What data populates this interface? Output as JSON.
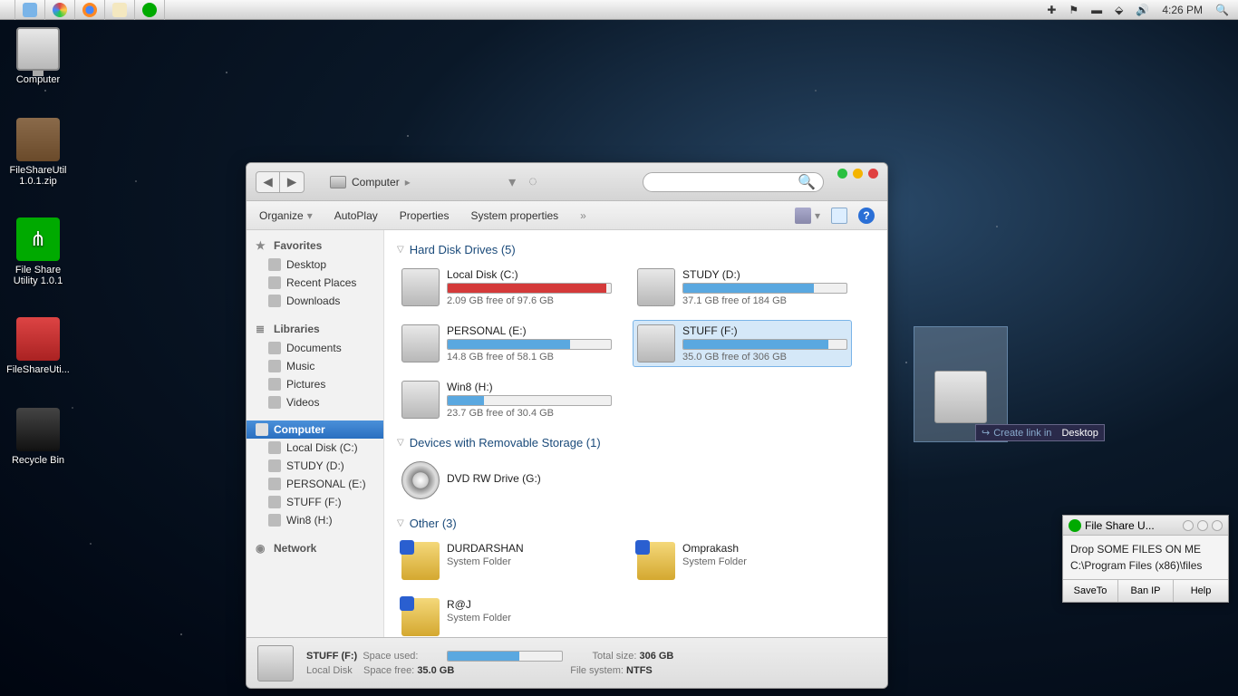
{
  "menubar": {
    "time": "4:26 PM"
  },
  "desktop": [
    {
      "name": "Computer"
    },
    {
      "name": "FileShareUtil 1.0.1.zip"
    },
    {
      "name": "File Share Utility 1.0.1"
    },
    {
      "name": "FileShareUti..."
    },
    {
      "name": "Recycle Bin"
    }
  ],
  "explorer": {
    "breadcrumb": "Computer",
    "toolbar": {
      "organize": "Organize",
      "autoplay": "AutoPlay",
      "properties": "Properties",
      "sysprops": "System properties"
    },
    "sidebar": {
      "favorites": {
        "label": "Favorites",
        "items": [
          "Desktop",
          "Recent Places",
          "Downloads"
        ]
      },
      "libraries": {
        "label": "Libraries",
        "items": [
          "Documents",
          "Music",
          "Pictures",
          "Videos"
        ]
      },
      "computer": {
        "label": "Computer",
        "items": [
          "Local Disk (C:)",
          "STUDY (D:)",
          "PERSONAL (E:)",
          "STUFF (F:)",
          "Win8 (H:)"
        ]
      },
      "network": {
        "label": "Network"
      }
    },
    "groups": {
      "hdd": {
        "label": "Hard Disk Drives (5)"
      },
      "removable": {
        "label": "Devices with Removable Storage (1)"
      },
      "other": {
        "label": "Other (3)"
      }
    },
    "drives": [
      {
        "name": "Local Disk (C:)",
        "free": "2.09 GB free of 97.6 GB",
        "pct": 97,
        "color": "#d43a3a"
      },
      {
        "name": "STUDY (D:)",
        "free": "37.1 GB free of 184 GB",
        "pct": 80,
        "color": "#5aa8e0"
      },
      {
        "name": "PERSONAL (E:)",
        "free": "14.8 GB free of 58.1 GB",
        "pct": 75,
        "color": "#5aa8e0"
      },
      {
        "name": "STUFF (F:)",
        "free": "35.0 GB free of 306 GB",
        "pct": 89,
        "color": "#5aa8e0",
        "selected": true
      },
      {
        "name": "Win8 (H:)",
        "free": "23.7 GB free of 30.4 GB",
        "pct": 22,
        "color": "#5aa8e0"
      }
    ],
    "dvd": {
      "name": "DVD RW Drive (G:)"
    },
    "others": [
      {
        "name": "DURDARSHAN",
        "sub": "System Folder"
      },
      {
        "name": "Omprakash",
        "sub": "System Folder"
      },
      {
        "name": "R@J",
        "sub": "System Folder"
      }
    ],
    "status": {
      "name": "STUFF (F:)",
      "type": "Local Disk",
      "used_label": "Space used:",
      "free_label": "Space free:",
      "free_val": "35.0 GB",
      "total_label": "Total size:",
      "total_val": "306 GB",
      "fs_label": "File system:",
      "fs_val": "NTFS"
    }
  },
  "drag_tip": {
    "pre": "Create link in",
    "dest": "Desktop"
  },
  "util": {
    "title": "File Share U...",
    "line1": "Drop SOME FILES ON ME",
    "line2": "C:\\Program Files (x86)\\files",
    "buttons": {
      "saveto": "SaveTo",
      "banip": "Ban IP",
      "help": "Help"
    }
  }
}
